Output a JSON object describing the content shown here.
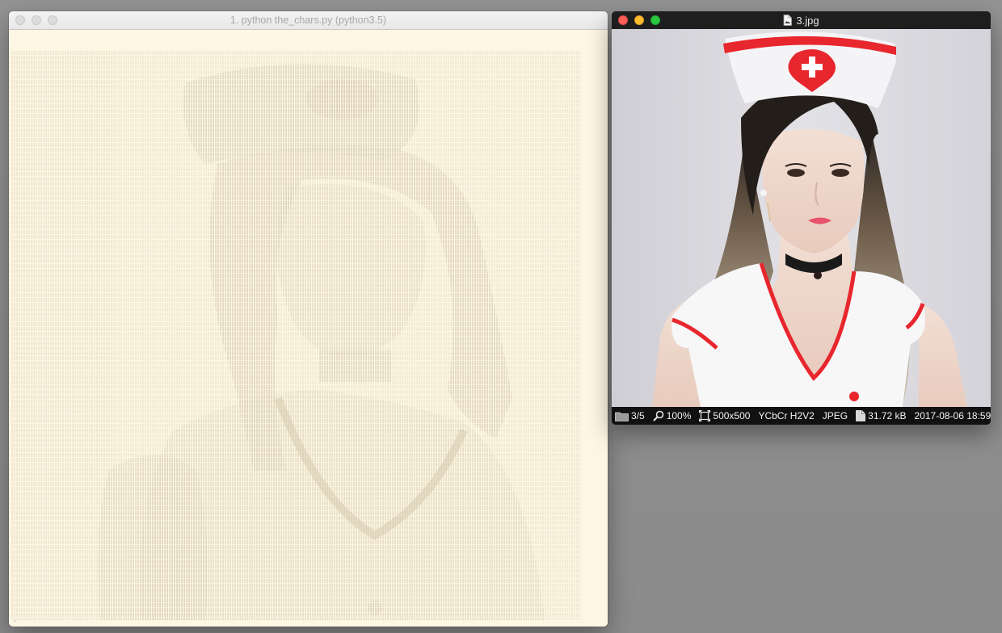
{
  "terminal": {
    "title": "1. python the_chars.py (python3.5)",
    "cursor_text": "'"
  },
  "viewer": {
    "title": "3.jpg",
    "image_subject": "nurse costume portrait",
    "status": {
      "index": "3/5",
      "zoom": "100%",
      "dimensions": "500x500",
      "color_space": "YCbCr H2V2",
      "format": "JPEG",
      "file_size": "31.72 kB",
      "date": "2017-08-06 18:59",
      "overflow": "3"
    }
  },
  "colors": {
    "terminal_bg": "#fdf6e3",
    "ascii_fg": "#e3d9c2",
    "accent_red": "#e8262d"
  },
  "icons": {
    "folder": "folder-icon",
    "magnifier": "magnifier-icon",
    "dimensions": "dimensions-icon",
    "document": "document-icon"
  }
}
